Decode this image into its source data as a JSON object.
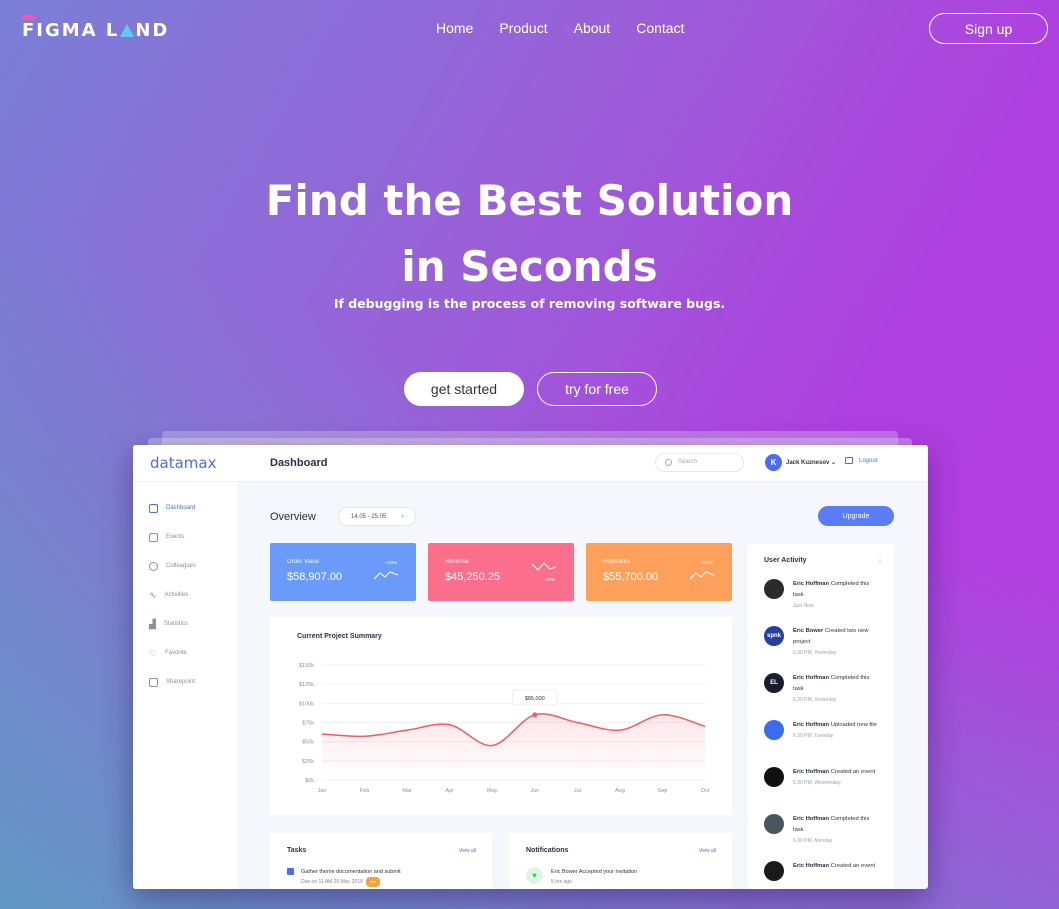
{
  "brand": {
    "logo_part1": "FIGMA L",
    "logo_part2": "ND"
  },
  "nav": {
    "items": [
      {
        "label": "Home"
      },
      {
        "label": "Product"
      },
      {
        "label": "About"
      },
      {
        "label": "Contact"
      }
    ],
    "signup_label": "Sign up"
  },
  "hero": {
    "title_line1": "Find the Best Solution",
    "title_line2": "in Seconds",
    "subtitle": "If debugging is the process of removing software bugs.",
    "primary_cta": "get started",
    "secondary_cta": "try for free"
  },
  "dashboard": {
    "logo": "datamax",
    "title": "Dashboard",
    "search_placeholder": "Search",
    "user_initial": "K",
    "user_name": "Jack Kuznesov",
    "logout": "Logout",
    "sidebar": [
      {
        "label": "Dashboard",
        "icon": "dashboard-icon"
      },
      {
        "label": "Events",
        "icon": "calendar-icon"
      },
      {
        "label": "Colleagues",
        "icon": "user-icon"
      },
      {
        "label": "Activities",
        "icon": "pulse-icon"
      },
      {
        "label": "Statistics",
        "icon": "bar-chart-icon"
      },
      {
        "label": "Favorite",
        "icon": "heart-icon"
      },
      {
        "label": "Sharepoint",
        "icon": "share-icon"
      }
    ],
    "overview_label": "Overview",
    "date_range": "14.05 - 25.05",
    "upgrade_label": "Upgrade",
    "stats": [
      {
        "label": "Order Value",
        "value": "$58,907.00",
        "change": "+20%",
        "color": "#6a9bfb"
      },
      {
        "label": "Revenue",
        "value": "$45,250.25",
        "change": "-10%",
        "color": "#fb6e8c"
      },
      {
        "label": "Payments",
        "value": "$55,700.00",
        "change": "+20%",
        "color": "#fca05c"
      }
    ],
    "summary_title": "Current Project Summary",
    "tooltip_value": "$85,000",
    "activity_title": "User Activity",
    "activities": [
      {
        "initials": "",
        "name": "Eric Hoffman",
        "text": "Completed this task",
        "time": "Just Now",
        "color": "#2b2b2b"
      },
      {
        "initials": "spnk",
        "name": "Eric Bower",
        "text": "Created two new project",
        "time": "6.30 PM, Yesterday",
        "color": "#2340a0"
      },
      {
        "initials": "EL",
        "name": "Eric Hoffman",
        "text": "Completed this task",
        "time": "6.30 PM, Yesterday",
        "color": "#1c1c2e"
      },
      {
        "initials": "",
        "name": "Eric Hoffman",
        "text": "Uploaded new file",
        "time": "6.30 PM, Tuesday",
        "color": "#3b6cf0"
      },
      {
        "initials": "",
        "name": "Eric Hoffman",
        "text": "Created an event",
        "time": "6.30 PM, Wednesday",
        "color": "#111111"
      },
      {
        "initials": "",
        "name": "Eric Hoffman",
        "text": "Completed this task",
        "time": "6.30 PM, Monday",
        "color": "#4a5560"
      },
      {
        "initials": "",
        "name": "Eric Hoffman",
        "text": "Created an event",
        "time": "",
        "color": "#1a1a1a"
      }
    ],
    "tasks": {
      "title": "Tasks",
      "link": "View all",
      "item_text": "Gather theme documentation and submit",
      "item_due": "Due on 11 AM 25 Mar, 2018",
      "item_badge": "Hot"
    },
    "notifications": {
      "title": "Notifications",
      "link": "View all",
      "item_name": "Eric Bower",
      "item_text": "Accepted your invitation",
      "item_time": "5 hrs ago"
    }
  },
  "chart_data": {
    "type": "line",
    "title": "Current Project Summary",
    "categories": [
      "Jan",
      "Feb",
      "Mar",
      "Apr",
      "May",
      "Jun",
      "Jul",
      "Aug",
      "Sep",
      "Oct"
    ],
    "series": [
      {
        "values": [
          60000,
          57000,
          65000,
          72000,
          45000,
          85000,
          75000,
          65000,
          85000,
          70000
        ]
      }
    ],
    "yticks": [
      "$0k",
      "$25k",
      "$50k",
      "$75k",
      "$100k",
      "$125k",
      "$150k"
    ],
    "ylim": [
      0,
      150000
    ],
    "annotation": "$85,000"
  }
}
